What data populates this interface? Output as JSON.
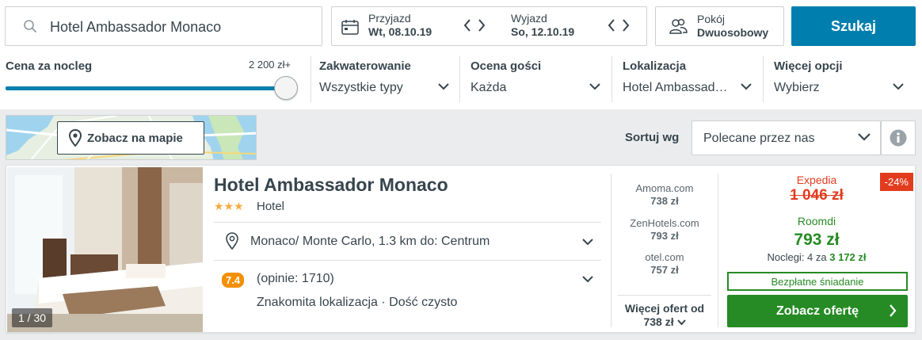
{
  "search": {
    "destination": "Hotel Ambassador Monaco",
    "checkin_label": "Przyjazd",
    "checkin_value": "Wt, 08.10.19",
    "checkout_label": "Wyjazd",
    "checkout_value": "So, 12.10.19",
    "room_label": "Pokój",
    "room_value": "Dwuosobowy",
    "search_button": "Szukaj"
  },
  "filters": {
    "price_label": "Cena za nocleg",
    "price_max": "2 200 zł+",
    "price_slider_fraction": 1.0,
    "items": [
      {
        "title": "Zakwaterowanie",
        "value": "Wszystkie typy"
      },
      {
        "title": "Ocena gości",
        "value": "Każda"
      },
      {
        "title": "Lokalizacja",
        "value": "Hotel Ambassad…"
      },
      {
        "title": "Więcej opcji",
        "value": "Wybierz"
      }
    ]
  },
  "toolbar": {
    "map_button": "Zobacz na mapie",
    "sort_label": "Sortuj wg",
    "sort_value": "Polecane przez nas"
  },
  "result": {
    "photo_counter": "1 / 30",
    "name": "Hotel Ambassador Monaco",
    "stars": "★★★",
    "type": "Hotel",
    "location": "Monaco/ Monte Carlo, 1.3 km do: Centrum",
    "rating": "7.4",
    "reviews": "(opinie: 1710)",
    "tags": "Znakomita lokalizacja · Dość czysto",
    "offers": [
      {
        "site": "Amoma.com",
        "price": "738 zł"
      },
      {
        "site": "ZenHotels.com",
        "price": "793 zł"
      },
      {
        "site": "otel.com",
        "price": "757 zł"
      }
    ],
    "more_offers_line1": "Więcej ofert od",
    "more_offers_line2": "738 zł",
    "deal": {
      "discount": "-24%",
      "old_source": "Expedia",
      "old_price": "1 046 zł",
      "new_source": "Roomdi",
      "new_price": "793 zł",
      "nights_text": "Noclegi: 4 za",
      "nights_total": "3 172 zł",
      "badge": "Bezpłatne śniadanie",
      "cta": "Zobacz ofertę"
    }
  },
  "colors": {
    "primary_blue": "#007faf",
    "deal_green": "#268b24",
    "discount_red": "#e23c1e",
    "rating_orange": "#f48f00"
  }
}
